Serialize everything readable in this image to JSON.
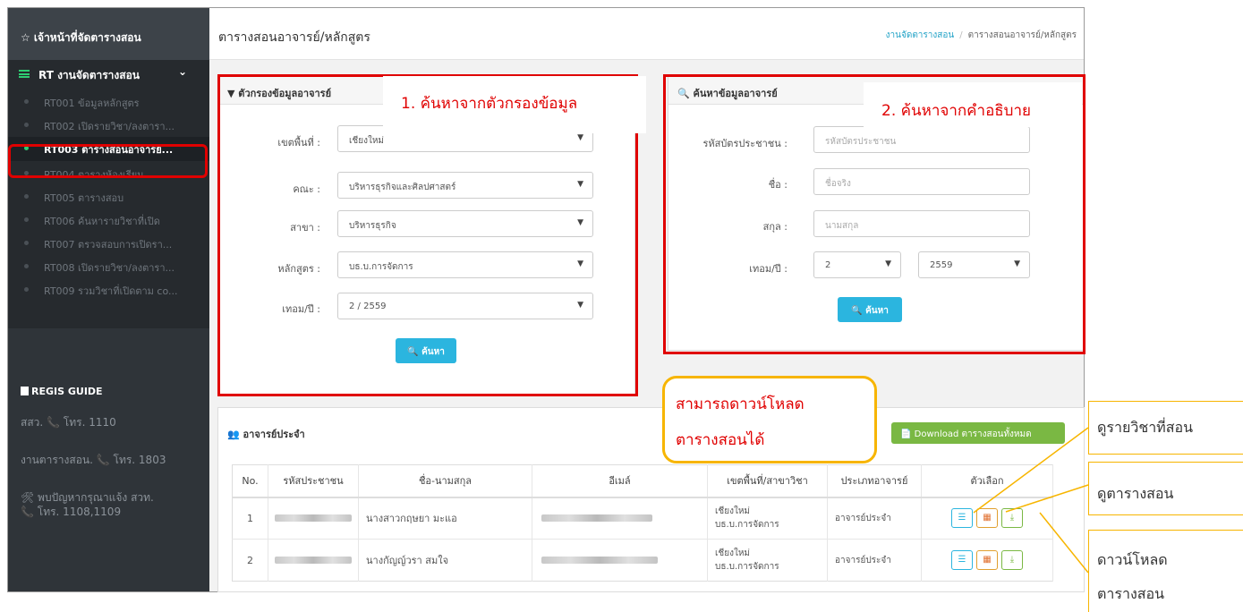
{
  "sidebar": {
    "header": "☆ เจ้าหน้าที่จัดตารางสอน",
    "group_label": "RT งานจัดตารางสอน",
    "items": [
      {
        "label": "RT001 ข้อมูลหลักสูตร"
      },
      {
        "label": "RT002 เปิดรายวิชา/ลงตารา..."
      },
      {
        "label": "RT003 ตารางสอนอาจารย์..."
      },
      {
        "label": "RT004 ตารางห้องเรียน"
      },
      {
        "label": "RT005 ตารางสอบ"
      },
      {
        "label": "RT006 ค้นหารายวิชาที่เปิด"
      },
      {
        "label": "RT007 ตรวจสอบการเปิดรา..."
      },
      {
        "label": "RT008 เปิดรายวิชา/ลงตารา..."
      },
      {
        "label": "RT009 รวมวิชาที่เปิดตาม co..."
      }
    ],
    "guide_title": "REGIS GUIDE",
    "contacts": [
      "สสว. 📞 โทร. 1110",
      "งานตารางสอน. 📞 โทร. 1803",
      "🛠 พบปัญหากรุณาแจ้ง สวท.",
      "📞 โทร. 1108,1109"
    ]
  },
  "header": {
    "title": "ตารางสอนอาจารย์/หลักสูตร",
    "breadcrumb_link": "งานจัดตารางสอน",
    "breadcrumb_sep": "/",
    "breadcrumb_current": "ตารางสอนอาจารย์/หลักสูตร"
  },
  "filter_panel": {
    "title": "ตัวกรองข้อมูลอาจารย์",
    "fields": [
      {
        "label": "เขตพื้นที่ :",
        "value": "เชียงใหม่"
      },
      {
        "label": "คณะ :",
        "value": "บริหารธุรกิจและศิลปศาสตร์"
      },
      {
        "label": "สาขา :",
        "value": "บริหารธุรกิจ"
      },
      {
        "label": "หลักสูตร :",
        "value": "บธ.บ.การจัดการ"
      },
      {
        "label": "เทอม/ปี :",
        "value": "2 / 2559"
      }
    ],
    "search_label": "ค้นหา"
  },
  "search_panel": {
    "title": "ค้นหาข้อมูลอาจารย์",
    "fields": [
      {
        "label": "รหัสบัตรประชาชน :",
        "placeholder": "รหัสบัตรประชาชน"
      },
      {
        "label": "ชื่อ :",
        "placeholder": "ชื่อจริง"
      },
      {
        "label": "สกุล :",
        "placeholder": "นามสกุล"
      }
    ],
    "term_label": "เทอม/ปี :",
    "term_value": "2",
    "year_value": "2559",
    "search_label": "ค้นหา"
  },
  "staff_panel": {
    "title": "อาจารย์ประจำ",
    "download_label": "Download ตารางสอนทั้งหมด",
    "columns": [
      "No.",
      "รหัสประชาชน",
      "ชื่อ-นามสกุล",
      "อีเมล์",
      "เขตพื้นที่/สาขาวิชา",
      "ประเภทอาจารย์",
      "ตัวเลือก"
    ],
    "rows": [
      {
        "no": "1",
        "name": "นางสาวกฤษยา มะแอ",
        "area": "เชียงใหม่",
        "major": "บธ.บ.การจัดการ",
        "type": "อาจารย์ประจำ"
      },
      {
        "no": "2",
        "name": "นางกัญญ์วรา สมใจ",
        "area": "เชียงใหม่",
        "major": "บธ.บ.การจัดการ",
        "type": "อาจารย์ประจำ"
      }
    ]
  },
  "annotations": {
    "callout_1": "1. ค้นหาจากตัวกรองข้อมูล",
    "callout_2": "2. ค้นหาจากคำอธิบาย",
    "download_note_line1": "สามารถดาวน์โหลด",
    "download_note_line2": "ตารางสอนได้",
    "side_1": "ดูรายวิชาที่สอน",
    "side_2": "ดูตารางสอน",
    "side_3_line1": "ดาวน์โหลด",
    "side_3_line2": "ตารางสอน"
  },
  "colors": {
    "sidebar_bg": "#2f3439",
    "accent_green": "#2ecc71",
    "search_button": "#2bb5df",
    "download_button": "#7ab843",
    "annotation_red": "#e00000",
    "annotation_yellow": "#f7b500"
  }
}
